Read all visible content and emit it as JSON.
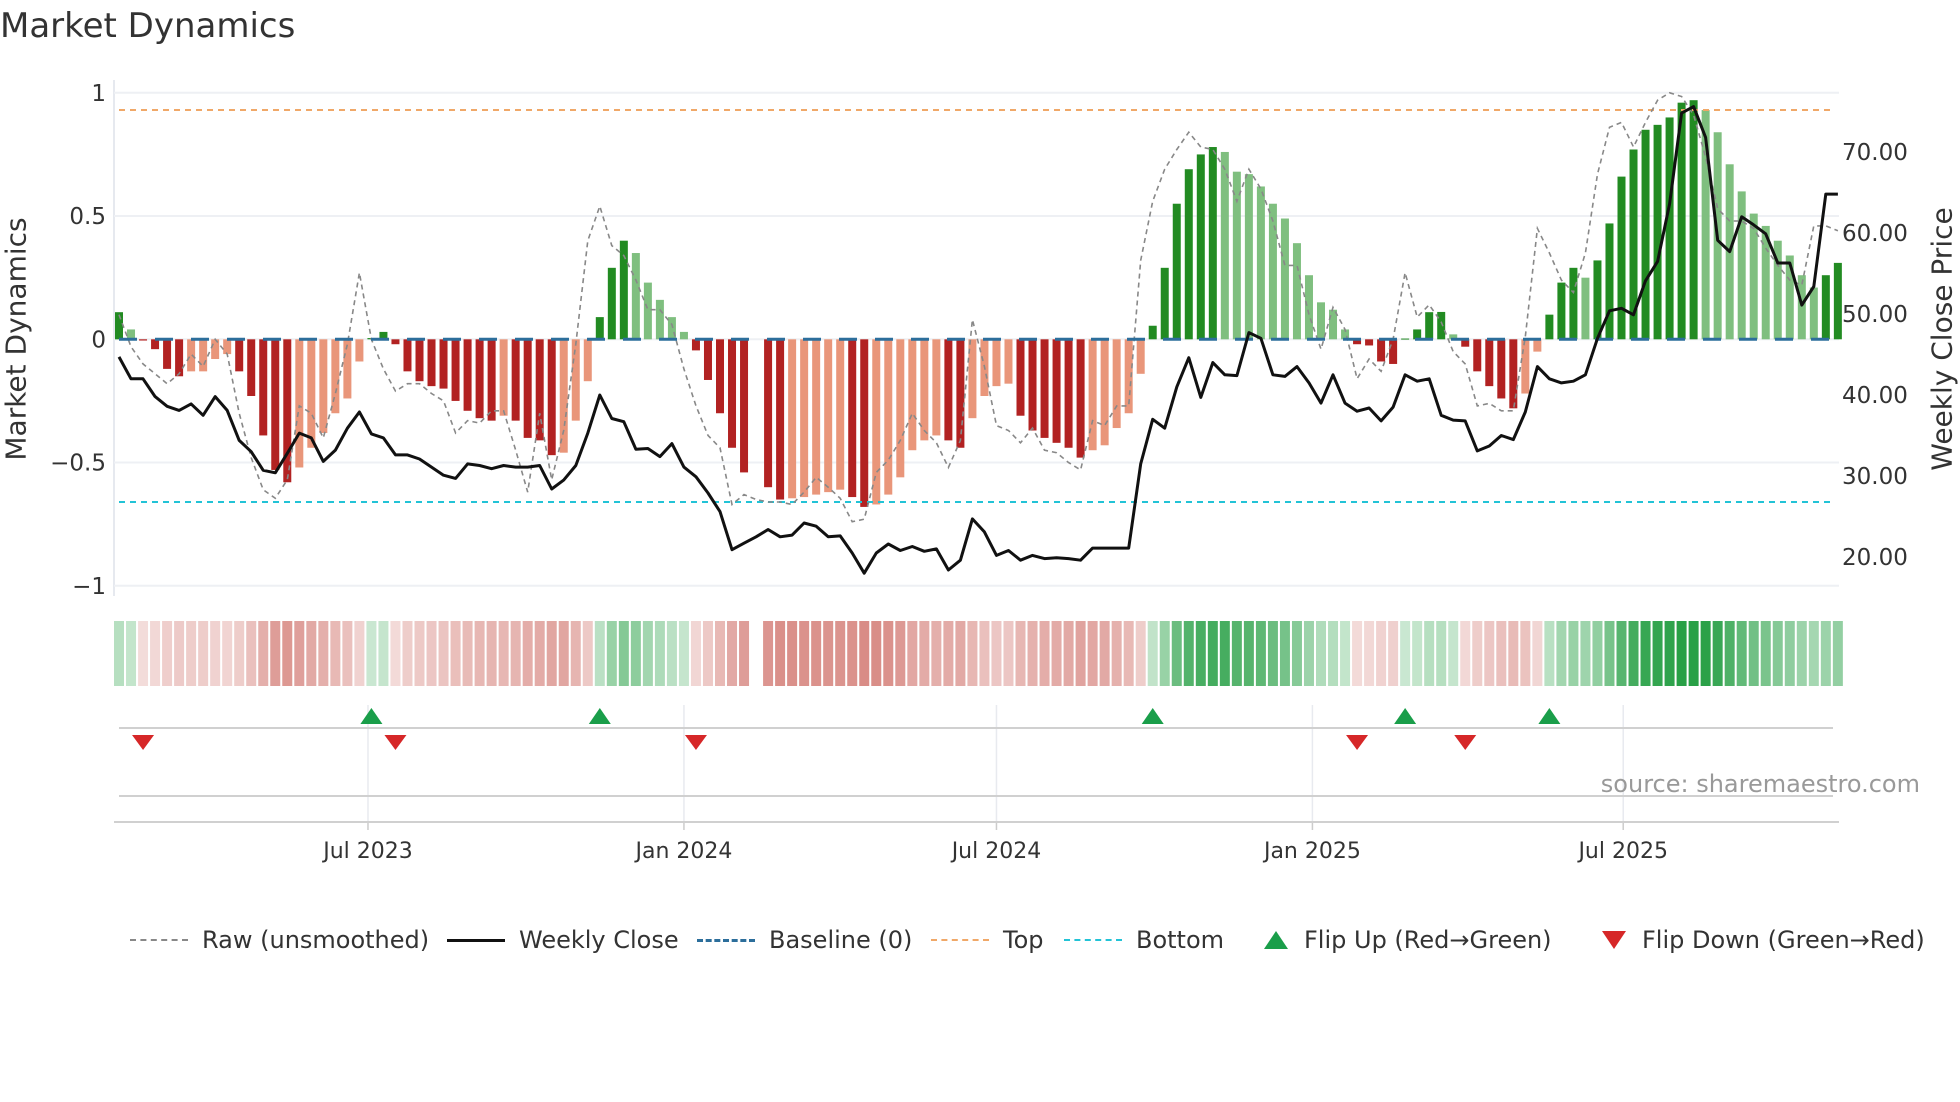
{
  "title": "Market Dynamics",
  "source": "source: sharemaestro.com",
  "chart_data": {
    "type": "bar",
    "title": "Market Dynamics",
    "ylabel": "Market Dynamics",
    "y2label": "Weekly Close Price",
    "ylim": [
      -1.02,
      1.08
    ],
    "y2lim": [
      16.4,
      77.2
    ],
    "y_ticks": [
      {
        "v": 1,
        "label": "1"
      },
      {
        "v": 0.5,
        "label": "0.5"
      },
      {
        "v": 0,
        "label": "0"
      },
      {
        "v": -0.5,
        "label": "−0.5"
      },
      {
        "v": -1,
        "label": "−1"
      }
    ],
    "y2_ticks": [
      {
        "v": 70,
        "label": "70.00"
      },
      {
        "v": 60,
        "label": "60.00"
      },
      {
        "v": 50,
        "label": "50.00"
      },
      {
        "v": 40,
        "label": "40.00"
      },
      {
        "v": 30,
        "label": "30.00"
      },
      {
        "v": 20,
        "label": "20.00"
      }
    ],
    "x_ticks": [
      {
        "date": "2023-07-01",
        "label": "Jul 2023"
      },
      {
        "date": "2024-01-01",
        "label": "Jan 2024"
      },
      {
        "date": "2024-07-01",
        "label": "Jul 2024"
      },
      {
        "date": "2025-01-01",
        "label": "Jan 2025"
      },
      {
        "date": "2025-07-01",
        "label": "Jul 2025"
      }
    ],
    "start_date": "2023-02-06",
    "frequency": "weekly",
    "top_level": 0.93,
    "bottom_level": -0.66,
    "baseline": 0,
    "series": [
      {
        "name": "Market Dynamics (smoothed)",
        "kind": "bar",
        "values": [
          0.11,
          0.04,
          -0.005,
          -0.04,
          -0.12,
          -0.15,
          -0.13,
          -0.13,
          -0.08,
          -0.06,
          -0.13,
          -0.23,
          -0.39,
          -0.53,
          -0.58,
          -0.52,
          -0.44,
          -0.38,
          -0.3,
          -0.24,
          -0.09,
          0.005,
          0.03,
          -0.02,
          -0.13,
          -0.17,
          -0.19,
          -0.2,
          -0.25,
          -0.29,
          -0.32,
          -0.33,
          -0.31,
          -0.33,
          -0.4,
          -0.41,
          -0.47,
          -0.46,
          -0.33,
          -0.17,
          0.09,
          0.29,
          0.4,
          0.35,
          0.23,
          0.16,
          0.09,
          0.03,
          -0.045,
          -0.165,
          -0.3,
          -0.44,
          -0.54,
          null,
          -0.6,
          -0.65,
          -0.645,
          -0.64,
          -0.63,
          -0.62,
          -0.61,
          -0.64,
          -0.68,
          -0.67,
          -0.63,
          -0.56,
          -0.45,
          -0.41,
          -0.39,
          -0.41,
          -0.44,
          -0.32,
          -0.23,
          -0.19,
          -0.18,
          -0.31,
          -0.37,
          -0.4,
          -0.42,
          -0.44,
          -0.48,
          -0.45,
          -0.43,
          -0.36,
          -0.3,
          -0.14,
          0.055,
          0.29,
          0.55,
          0.69,
          0.75,
          0.78,
          0.76,
          0.68,
          0.67,
          0.62,
          0.55,
          0.49,
          0.39,
          0.26,
          0.15,
          0.12,
          0.04,
          -0.02,
          -0.025,
          -0.09,
          -0.1,
          0.003,
          0.04,
          0.11,
          0.111,
          0.02,
          -0.03,
          -0.13,
          -0.19,
          -0.24,
          -0.28,
          -0.22,
          -0.05,
          0.1,
          0.23,
          0.29,
          0.25,
          0.32,
          0.47,
          0.66,
          0.77,
          0.85,
          0.87,
          0.9,
          0.96,
          0.97,
          0.93,
          0.84,
          0.71,
          0.6,
          0.51,
          0.46,
          0.4,
          0.34,
          0.26,
          0.21,
          0.26,
          0.31
        ]
      },
      {
        "name": "Raw (unsmoothed)",
        "kind": "line",
        "values": [
          0.1,
          -0.03,
          -0.1,
          -0.14,
          -0.18,
          -0.14,
          -0.06,
          -0.11,
          0.0,
          -0.06,
          -0.3,
          -0.48,
          -0.61,
          -0.645,
          -0.57,
          -0.27,
          -0.3,
          -0.4,
          -0.22,
          -0.02,
          0.27,
          0.0,
          -0.12,
          -0.21,
          -0.18,
          -0.18,
          -0.22,
          -0.25,
          -0.38,
          -0.33,
          -0.34,
          -0.29,
          -0.29,
          -0.45,
          -0.62,
          -0.3,
          -0.57,
          -0.37,
          -0.02,
          0.4,
          0.54,
          0.38,
          0.34,
          0.24,
          0.12,
          0.12,
          0.06,
          -0.12,
          -0.27,
          -0.39,
          -0.44,
          -0.67,
          -0.63,
          -0.65,
          -0.66,
          -0.66,
          -0.67,
          -0.62,
          -0.56,
          -0.6,
          -0.645,
          -0.74,
          -0.73,
          -0.54,
          -0.49,
          -0.41,
          -0.3,
          -0.37,
          -0.42,
          -0.52,
          -0.41,
          0.08,
          -0.11,
          -0.35,
          -0.37,
          -0.42,
          -0.36,
          -0.45,
          -0.46,
          -0.5,
          -0.53,
          -0.33,
          -0.35,
          -0.27,
          -0.27,
          0.32,
          0.56,
          0.69,
          0.77,
          0.84,
          0.78,
          0.77,
          0.69,
          0.56,
          0.69,
          0.61,
          0.48,
          0.3,
          0.3,
          0.1,
          -0.04,
          0.13,
          0.04,
          -0.16,
          -0.08,
          -0.13,
          0.0,
          0.27,
          0.09,
          0.14,
          0.07,
          -0.05,
          -0.1,
          -0.27,
          -0.26,
          -0.29,
          -0.29,
          0.01,
          0.45,
          0.35,
          0.24,
          0.19,
          0.35,
          0.67,
          0.86,
          0.88,
          0.78,
          0.88,
          0.97,
          1.0,
          0.985,
          0.91,
          0.74,
          0.53,
          0.48,
          0.48,
          0.45,
          0.37,
          0.3,
          0.24,
          0.22,
          0.46,
          0.46,
          0.44
        ]
      },
      {
        "name": "Weekly Close",
        "kind": "line",
        "axis": "right",
        "values": [
          44.7,
          42.0,
          42.0,
          39.8,
          38.6,
          38.1,
          38.9,
          37.5,
          39.8,
          38.1,
          34.4,
          33.0,
          30.7,
          30.4,
          32.8,
          35.3,
          34.7,
          31.8,
          33.2,
          35.9,
          37.9,
          35.2,
          34.7,
          32.6,
          32.6,
          32.1,
          31.1,
          30.1,
          29.7,
          31.5,
          31.3,
          30.9,
          31.3,
          31.1,
          31.1,
          31.3,
          28.4,
          29.5,
          31.3,
          35.3,
          40.0,
          37.1,
          36.7,
          33.3,
          33.4,
          32.4,
          34.0,
          31.1,
          29.9,
          27.9,
          25.6,
          20.9,
          21.7,
          22.5,
          23.4,
          22.5,
          22.7,
          24.2,
          23.8,
          22.5,
          22.6,
          20.5,
          18.0,
          20.5,
          21.6,
          20.8,
          21.3,
          20.7,
          21.0,
          18.4,
          19.6,
          24.7,
          23.1,
          20.2,
          20.8,
          19.6,
          20.2,
          19.8,
          19.9,
          19.8,
          19.6,
          21.1,
          21.1,
          21.1,
          21.1,
          31.5,
          37.0,
          35.9,
          41.0,
          44.6,
          39.7,
          44.0,
          42.5,
          42.4,
          47.7,
          47.0,
          42.5,
          42.3,
          43.5,
          41.5,
          39.0,
          42.5,
          39.0,
          38.0,
          38.4,
          36.8,
          38.5,
          42.5,
          41.7,
          42.0,
          37.5,
          36.9,
          36.8,
          33.1,
          33.7,
          35.0,
          34.5,
          37.9,
          43.5,
          42.0,
          41.5,
          41.7,
          42.5,
          47.0,
          50.4,
          50.7,
          49.9,
          54.1,
          56.5,
          63.6,
          74.8,
          75.6,
          71.8,
          59.1,
          57.7,
          62.0,
          61.0,
          59.9,
          56.3,
          56.3,
          51.1,
          53.4,
          64.8,
          64.8
        ]
      }
    ],
    "flip_up_weeks": [
      22,
      41,
      87,
      108,
      120
    ],
    "flip_down_weeks": [
      3,
      24,
      49,
      104,
      113
    ],
    "legend": {
      "placement": "bottom",
      "items": [
        {
          "key": "raw",
          "label": "Raw (unsmoothed)"
        },
        {
          "key": "close",
          "label": "Weekly Close"
        },
        {
          "key": "baseline",
          "label": "Baseline (0)"
        },
        {
          "key": "top",
          "label": "Top"
        },
        {
          "key": "bottom",
          "label": "Bottom"
        },
        {
          "key": "flip_up",
          "label": "Flip Up (Red→Green)"
        },
        {
          "key": "flip_down",
          "label": "Flip Down (Green→Red)"
        }
      ]
    },
    "colors": {
      "bar_pos_strong": "#228b22",
      "bar_pos_weak": "#7fbf7f",
      "bar_neg_strong": "#b22222",
      "bar_neg_weak": "#e9967a",
      "raw": "#888888",
      "close": "#111111",
      "baseline": "#2c6e9b",
      "top": "#f0a868",
      "bottom": "#22c3d6",
      "flip_up": "#1a9e4a",
      "flip_down": "#d62728"
    }
  }
}
